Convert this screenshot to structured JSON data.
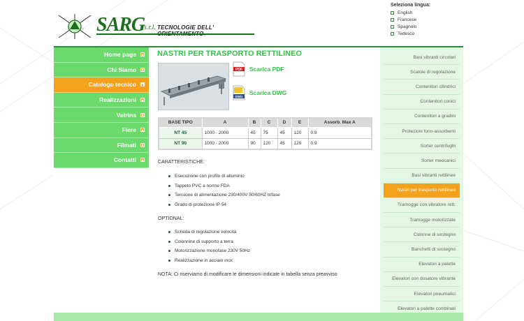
{
  "header": {
    "brand_name": "SARG",
    "brand_suffix": "s.r.l.",
    "brand_tagline": "TECNOLOGIE DELL' ORIENTAMENTO",
    "language_title": "Seleziona lingua:",
    "languages": [
      "English",
      "Francese",
      "Spagnolo",
      "Tedesco"
    ]
  },
  "left_nav": [
    {
      "label": "Home page",
      "active": false
    },
    {
      "label": "Chi Siamo",
      "active": false
    },
    {
      "label": "Catalogo tecnico",
      "active": true
    },
    {
      "label": "Realizzazioni",
      "active": false
    },
    {
      "label": "Vetrina",
      "active": false
    },
    {
      "label": "Fiere",
      "active": false
    },
    {
      "label": "Filmati",
      "active": false
    },
    {
      "label": "Contatti",
      "active": false
    }
  ],
  "main": {
    "title": "NASTRI PER TRASPORTO RETTILINEO",
    "download_pdf": "Scarica PDF",
    "download_dwg": "Scarica DWG",
    "table": {
      "headers": [
        "BASE TIPO",
        "A",
        "B",
        "C",
        "D",
        "E",
        "Assorb. Max A"
      ],
      "rows": [
        [
          "NT 45",
          "1000 - 2000",
          "45",
          "75",
          "45",
          "120",
          "0.9"
        ],
        [
          "NT 90",
          "1000 - 2000",
          "90",
          "120",
          "45",
          "120",
          "0.9"
        ]
      ]
    },
    "features_label": "CARATTERISTICHE:",
    "features": [
      "Esecuzione con profilo di alluminio",
      "Tappeto PVC a norme FDA",
      "Tensione di alimentazione 230/400V 50/60HZ trifase",
      "Grado di protezione IP 54"
    ],
    "optional_label": "OPTIONAL:",
    "optional": [
      "Scheda di regolazione velocità",
      "Colonnine di supporto a terra",
      "Motorizzazione monofase 230V 50Hz",
      "Realizzazione in acciaio inox"
    ],
    "note": "NOTA: Ci riserviamo di modificare le dimensioni indicate in tabella senza preavviso"
  },
  "right_nav": [
    {
      "label": "Basi vibranti circolari",
      "active": false
    },
    {
      "label": "Scatole di regolazione",
      "active": false
    },
    {
      "label": "Contenitori cilindrici",
      "active": false
    },
    {
      "label": "Contenitori conici",
      "active": false
    },
    {
      "label": "Contenitori a gradini",
      "active": false
    },
    {
      "label": "Protezioni fono-assorbenti",
      "active": false
    },
    {
      "label": "Sorter centrifughi",
      "active": false
    },
    {
      "label": "Sorter meccanici",
      "active": false
    },
    {
      "label": "Basi vibranti rettilinee",
      "active": false
    },
    {
      "label": "Nastri per trasporto rettilineo",
      "active": true
    },
    {
      "label": "Tramogge con vibratore rett.",
      "active": false
    },
    {
      "label": "Tramogge motorizzate",
      "active": false
    },
    {
      "label": "Colonne di sostegno",
      "active": false
    },
    {
      "label": "Banchetti di sostegno",
      "active": false
    },
    {
      "label": "Elevatori a palette",
      "active": false
    },
    {
      "label": "Elevatori con dosatore vibrante",
      "active": false
    },
    {
      "label": "Elevatori pneumatici",
      "active": false
    },
    {
      "label": "Elevatori a palette combinati",
      "active": false
    }
  ],
  "colors": {
    "nav_green": "#6bd96b",
    "active_orange": "#f4a11b",
    "title_green": "#37c04a",
    "brand_green": "#1b6e1b",
    "sidebar_bg": "#e3f7e3",
    "footer_green": "#a8e8a8"
  }
}
